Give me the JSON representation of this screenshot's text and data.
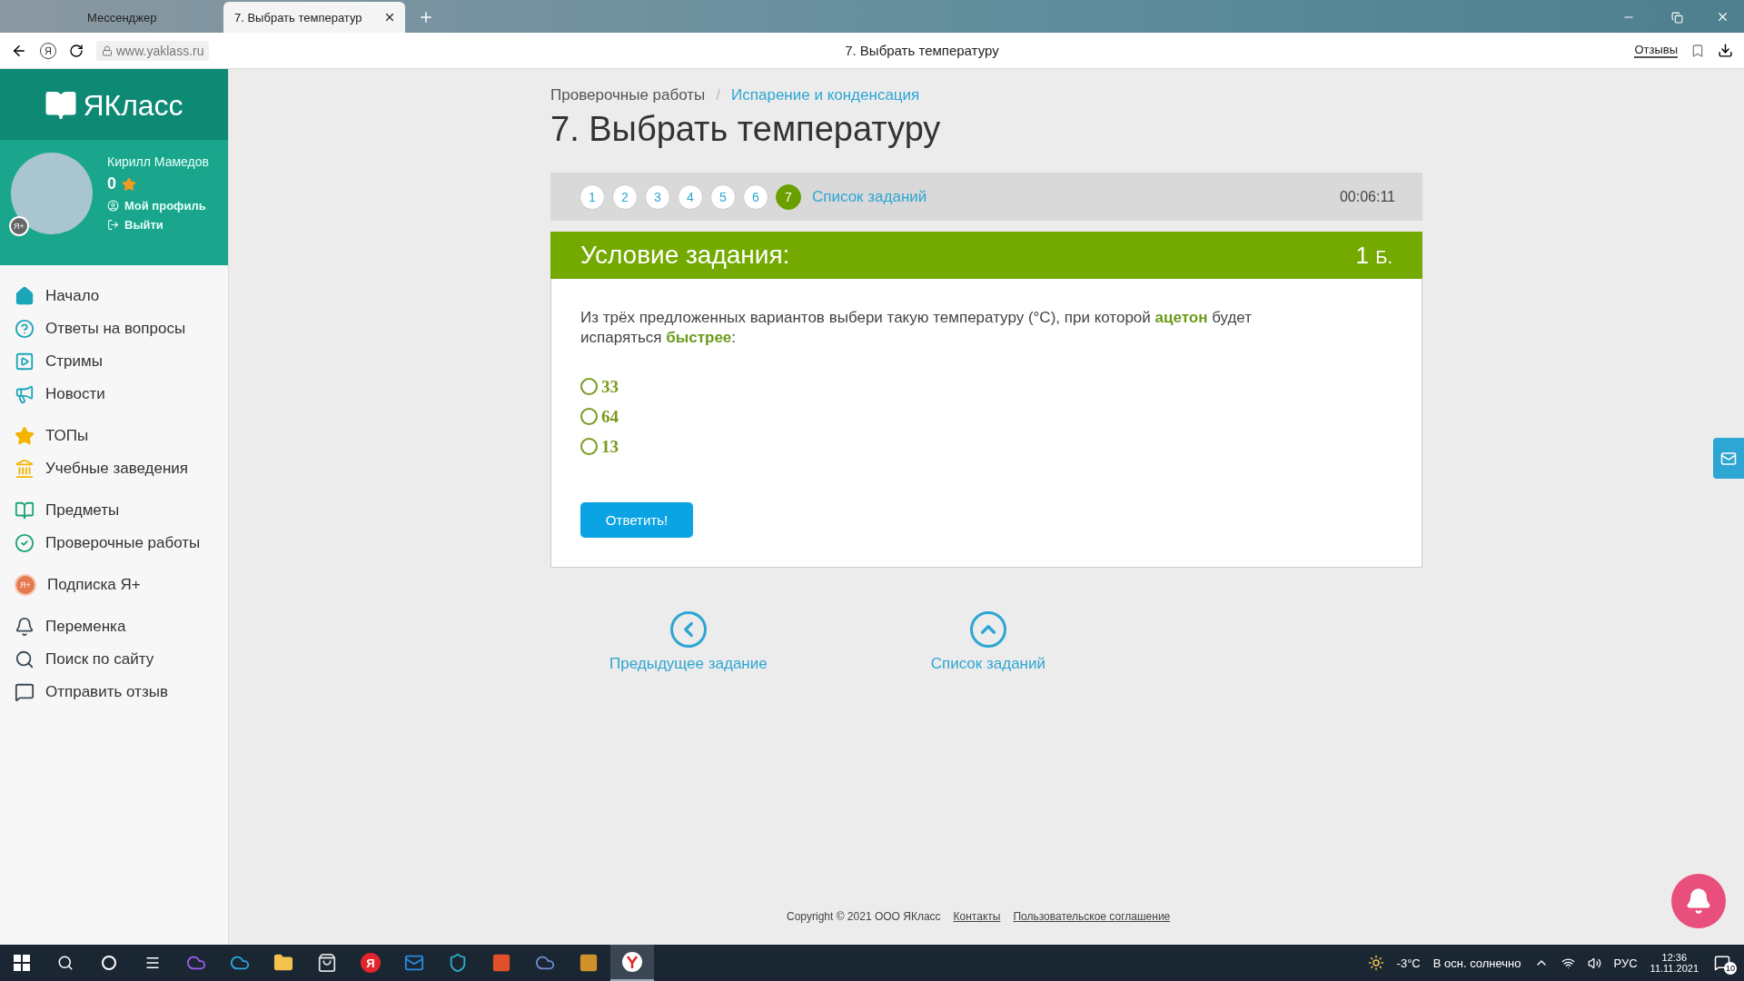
{
  "browser": {
    "tabs": [
      {
        "label": "Мессенджер",
        "selected": false
      },
      {
        "label": "7. Выбрать температур",
        "selected": true
      }
    ],
    "yandex_button": "Я",
    "url": "www.yaklass.ru",
    "page_title": "7. Выбрать температуру",
    "reviews": "Отзывы"
  },
  "sidebar": {
    "logo": "ЯКласс",
    "avatar_badge": "Я+",
    "user_name": "Кирилл Мамедов",
    "points": "0",
    "profile_links": [
      {
        "label": "Мой профиль",
        "kind": "profile"
      },
      {
        "label": "Выйти",
        "kind": "logout"
      }
    ],
    "groups": [
      [
        {
          "label": "Начало",
          "kind": "home"
        },
        {
          "label": "Ответы на вопросы",
          "kind": "help"
        },
        {
          "label": "Стримы",
          "kind": "stream"
        },
        {
          "label": "Новости",
          "kind": "news"
        }
      ],
      [
        {
          "label": "ТОПы",
          "kind": "top"
        },
        {
          "label": "Учебные заведения",
          "kind": "school"
        }
      ],
      [
        {
          "label": "Предметы",
          "kind": "subjects"
        },
        {
          "label": "Проверочные работы",
          "kind": "tests"
        }
      ],
      [
        {
          "label": "Подписка Я+",
          "kind": "subscription",
          "badge": "Я+"
        }
      ],
      [
        {
          "label": "Переменка",
          "kind": "bell"
        },
        {
          "label": "Поиск по сайту",
          "kind": "search"
        },
        {
          "label": "Отправить отзыв",
          "kind": "feedback"
        }
      ]
    ]
  },
  "main": {
    "breadcrumb_separator": "/",
    "breadcrumb": [
      {
        "label": "Проверочные работы",
        "kind": "text"
      },
      {
        "label": "Испарение и конденсация",
        "kind": "link"
      }
    ],
    "title": "7. Выбрать температуру",
    "pager": {
      "pages": [
        {
          "label": "1",
          "selected": false
        },
        {
          "label": "2",
          "selected": false
        },
        {
          "label": "3",
          "selected": false
        },
        {
          "label": "4",
          "selected": false
        },
        {
          "label": "5",
          "selected": false
        },
        {
          "label": "6",
          "selected": false
        },
        {
          "label": "7",
          "selected": true
        }
      ],
      "list_link": "Список заданий",
      "timer": "00:06:11"
    },
    "task": {
      "heading": "Условие задания:",
      "points": "1",
      "points_unit": "Б.",
      "question": "Из трёх предложенных вариантов выбери такую температуру (°C), при которой **ацетон** будет испаряться **быстрее**:",
      "options": [
        {
          "label": "33",
          "selected": false
        },
        {
          "label": "64",
          "selected": false
        },
        {
          "label": "13",
          "selected": false
        }
      ],
      "submit": "Ответить!"
    },
    "nav_links": [
      {
        "label": "Предыдущее задание",
        "kind": "previous"
      },
      {
        "label": "Список заданий",
        "kind": "list"
      }
    ]
  },
  "footer": {
    "copyright": "Copyright © 2021 ООО ЯКласс",
    "links": [
      "Контакты",
      "Пользовательское соглашение"
    ]
  },
  "taskbar": {
    "apps": [
      {
        "kind": "alice",
        "active": false
      },
      {
        "kind": "edge",
        "active": false
      },
      {
        "kind": "files",
        "active": false
      },
      {
        "kind": "store",
        "active": false
      },
      {
        "kind": "yandex",
        "label": "Я",
        "active": false
      },
      {
        "kind": "mail",
        "active": false
      },
      {
        "kind": "vpn",
        "active": false
      },
      {
        "kind": "office",
        "active": false
      },
      {
        "kind": "steam",
        "active": false
      },
      {
        "kind": "game",
        "active": false
      },
      {
        "kind": "browser",
        "active": true
      }
    ],
    "temperature": "-3°C",
    "weather": "В осн. солнечно",
    "language": "РУС",
    "time": "12:36",
    "date": "11.11.2021",
    "notifications": "10"
  }
}
